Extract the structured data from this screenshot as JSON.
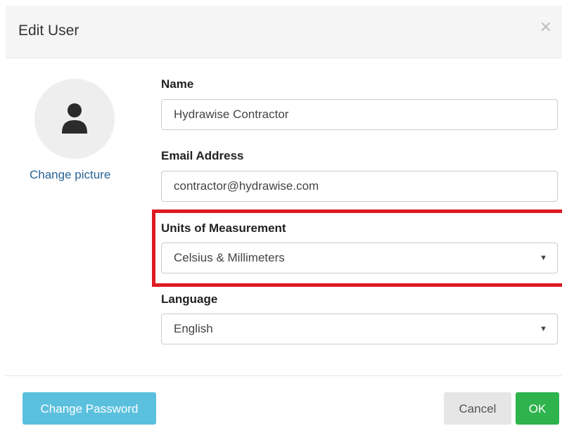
{
  "modal": {
    "title": "Edit User",
    "close_glyph": "×"
  },
  "avatar": {
    "icon": "user-icon",
    "change_picture_label": "Change picture"
  },
  "form": {
    "name": {
      "label": "Name",
      "value": "Hydrawise Contractor"
    },
    "email": {
      "label": "Email Address",
      "value": "contractor@hydrawise.com"
    },
    "units": {
      "label": "Units of Measurement",
      "selected": "Celsius & Millimeters"
    },
    "language": {
      "label": "Language",
      "selected": "English"
    }
  },
  "footer": {
    "change_password_label": "Change Password",
    "cancel_label": "Cancel",
    "ok_label": "OK"
  },
  "colors": {
    "highlight": "#dd1b20",
    "info_button": "#5bc0de",
    "ok_button": "#2eb34d",
    "link": "#2a6496"
  }
}
